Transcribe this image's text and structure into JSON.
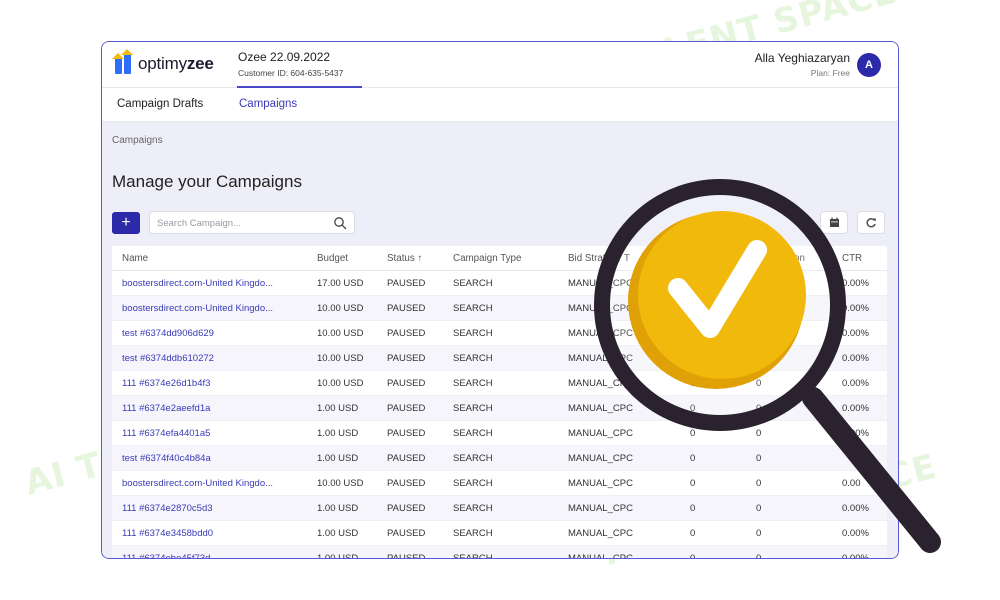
{
  "watermark": {
    "text": "AI TALENT SPACE"
  },
  "header": {
    "logo_prefix": "optimy",
    "logo_suffix": "zee",
    "account_name": "Ozee 22.09.2022",
    "customer_id": "Customer ID: 604-635-5437",
    "user_name": "Alla Yeghiazaryan",
    "user_plan": "Plan: Free",
    "avatar_initial": "A"
  },
  "tabs": [
    "Campaign Drafts",
    "Campaigns"
  ],
  "breadcrumb": "Campaigns",
  "page_title": "Manage your Campaigns",
  "toolbar": {
    "add_label": "+",
    "search_placeholder": "Search Campaign..."
  },
  "table": {
    "columns": [
      "Name",
      "Budget",
      "Status ↑",
      "Campaign Type",
      "Bid Strategy T",
      "on",
      "CTR"
    ],
    "rows": [
      [
        "boostersdirect.com-United Kingdo...",
        "17.00 USD",
        "PAUSED",
        "SEARCH",
        "MANUAL_CPC",
        "",
        "",
        "0.00%"
      ],
      [
        "boostersdirect.com-United Kingdo...",
        "10.00 USD",
        "PAUSED",
        "SEARCH",
        "MANUAL_CPC",
        "",
        "",
        "0.00%"
      ],
      [
        "test #6374dd906d629",
        "10.00 USD",
        "PAUSED",
        "SEARCH",
        "MANUAL_CPC",
        "",
        "",
        "0.00%"
      ],
      [
        "test #6374ddb610272",
        "10.00 USD",
        "PAUSED",
        "SEARCH",
        "MANUAL_CPC",
        "",
        "",
        "0.00%"
      ],
      [
        "111 #6374e26d1b4f3",
        "10.00 USD",
        "PAUSED",
        "SEARCH",
        "MANUAL_CPC",
        "0",
        "0",
        "0.00%"
      ],
      [
        "111 #6374e2aeefd1a",
        "1.00 USD",
        "PAUSED",
        "SEARCH",
        "MANUAL_CPC",
        "0",
        "0",
        "0.00%"
      ],
      [
        "111 #6374efa4401a5",
        "1.00 USD",
        "PAUSED",
        "SEARCH",
        "MANUAL_CPC",
        "0",
        "0",
        "0.00%"
      ],
      [
        "test #6374f40c4b84a",
        "1.00 USD",
        "PAUSED",
        "SEARCH",
        "MANUAL_CPC",
        "0",
        "0",
        ""
      ],
      [
        "boostersdirect.com-United Kingdo...",
        "10.00 USD",
        "PAUSED",
        "SEARCH",
        "MANUAL_CPC",
        "0",
        "0",
        "0.00"
      ],
      [
        "111 #6374e2870c5d3",
        "1.00 USD",
        "PAUSED",
        "SEARCH",
        "MANUAL_CPC",
        "0",
        "0",
        "0.00%"
      ],
      [
        "111 #6374e3458bdd0",
        "1.00 USD",
        "PAUSED",
        "SEARCH",
        "MANUAL_CPC",
        "0",
        "0",
        "0.00%"
      ],
      [
        "111 #6374ebe45f73d",
        "1.00 USD",
        "PAUSED",
        "SEARCH",
        "MANUAL_CPC",
        "0",
        "0",
        "0.00%"
      ]
    ]
  },
  "colors": {
    "brand": "#2c2aa8",
    "accent_yellow": "#f0b90b",
    "checkmark": "#ffffff",
    "handle": "#2b2230",
    "panel_bg": "#eeeef9"
  },
  "icons": [
    "search-icon",
    "calendar-icon",
    "refresh-icon",
    "sort-arrow-icon",
    "magnifier-check-illustration"
  ]
}
